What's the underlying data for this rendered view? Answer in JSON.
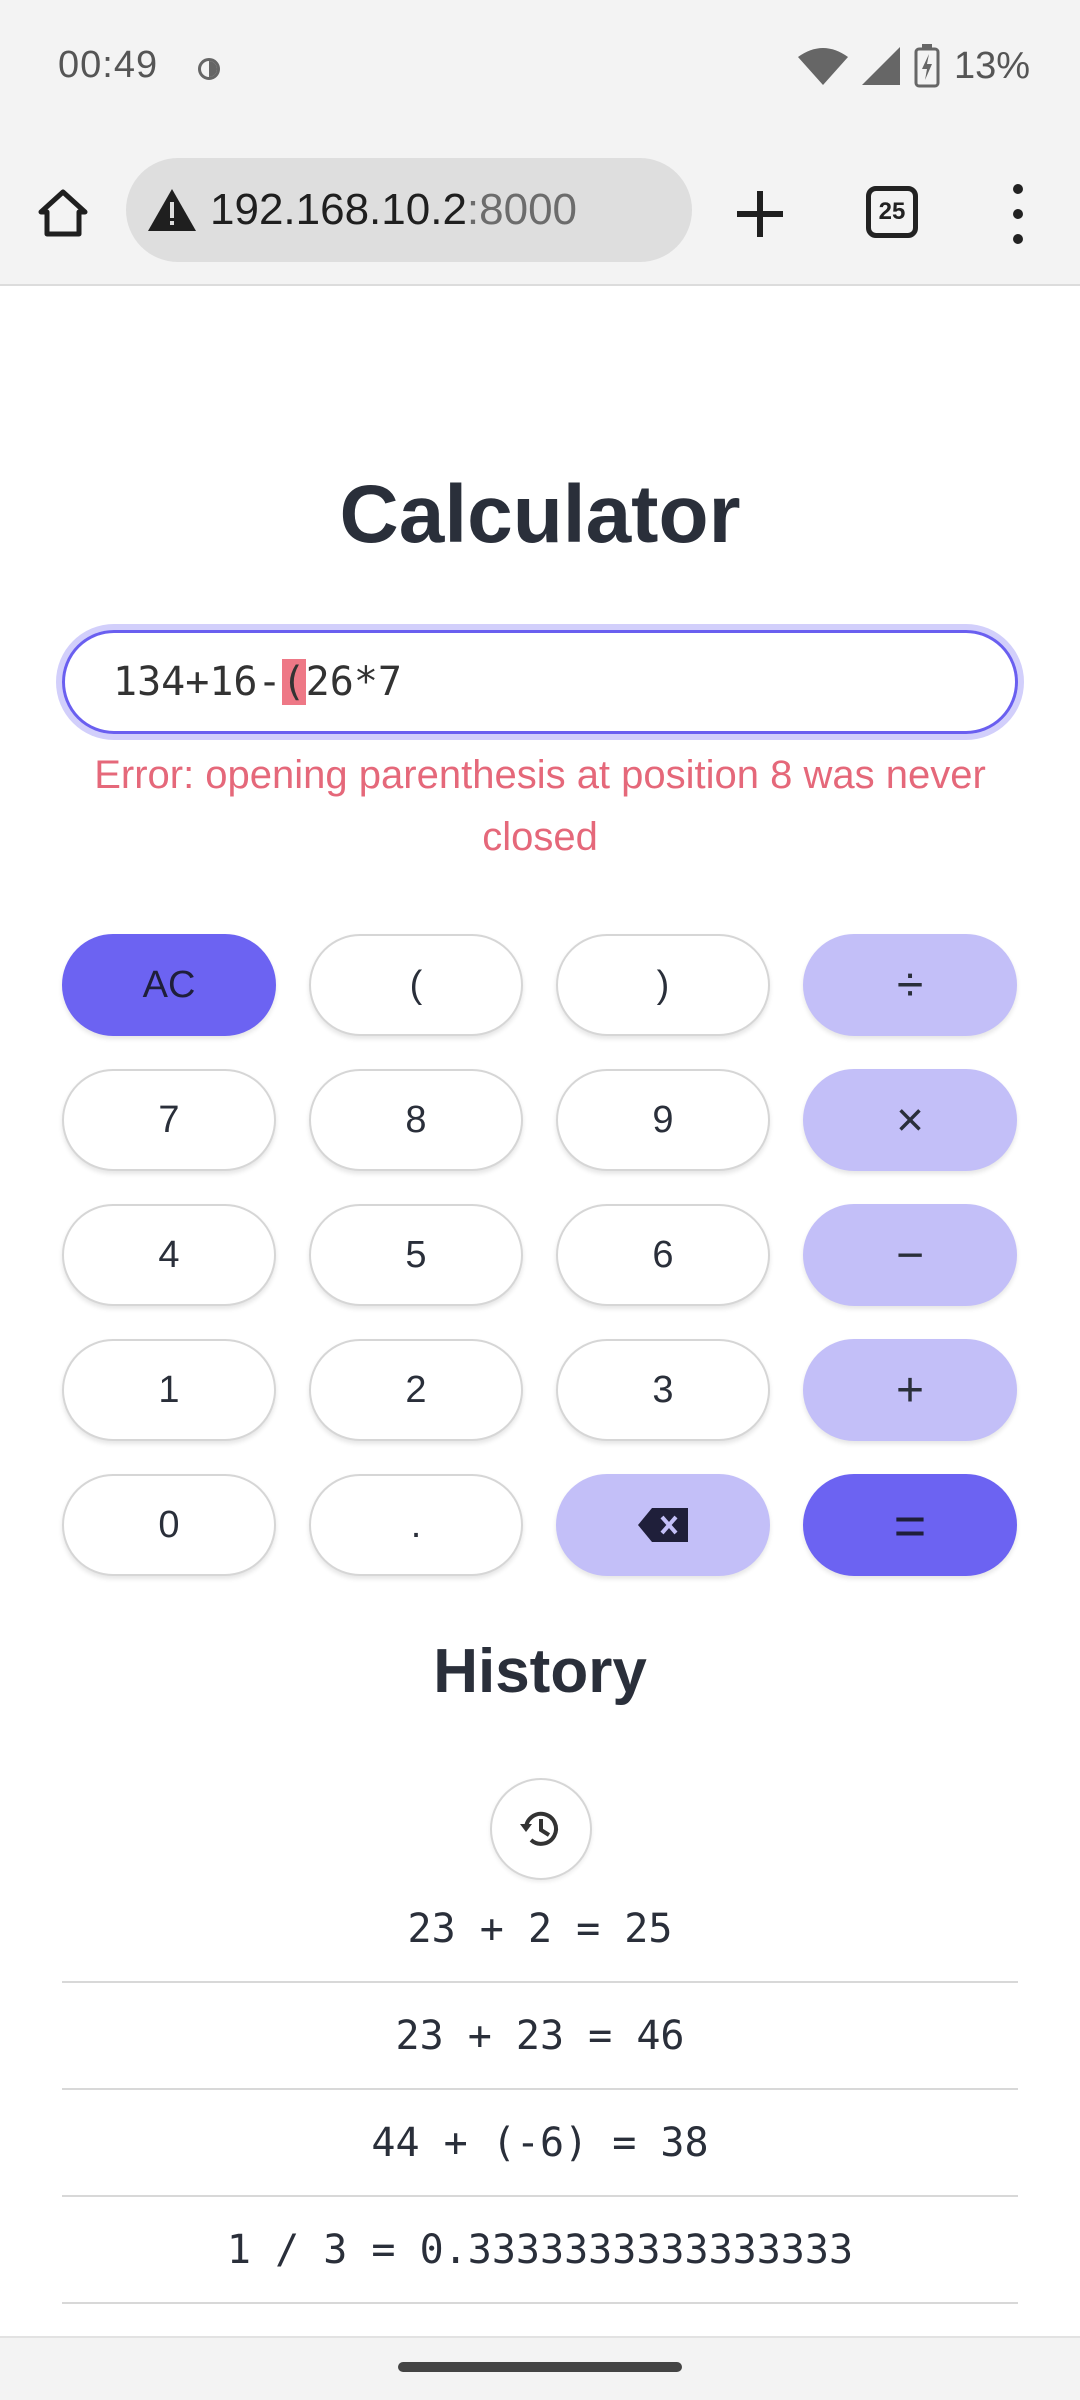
{
  "status_bar": {
    "time": "00:49",
    "battery": "13%"
  },
  "browser": {
    "url_host": "192.168.10.2",
    "url_port": ":8000",
    "tab_count": "25"
  },
  "page": {
    "title": "Calculator",
    "expression": {
      "before": "134+16-",
      "highlight": "(",
      "after": "26*7"
    },
    "error": "Error: opening parenthesis at position 8 was never closed"
  },
  "keypad": {
    "ac": "AC",
    "lparen": "(",
    "rparen": ")",
    "divide": "÷",
    "seven": "7",
    "eight": "8",
    "nine": "9",
    "multiply": "×",
    "four": "4",
    "five": "5",
    "six": "6",
    "minus": "−",
    "one": "1",
    "two": "2",
    "three": "3",
    "plus": "+",
    "zero": "0",
    "dot": ".",
    "backspace_icon": "backspace-icon",
    "equals": "="
  },
  "history": {
    "title": "History",
    "items": [
      "23 + 2 = 25",
      "23 + 23 = 46",
      "44 + (-6) = 38",
      "1 / 3 = 0.3333333333333333"
    ]
  },
  "colors": {
    "accent": "#6c63f2",
    "operator": "#c3bff8",
    "error": "#e5687a",
    "focus": "#6a5ff0"
  }
}
